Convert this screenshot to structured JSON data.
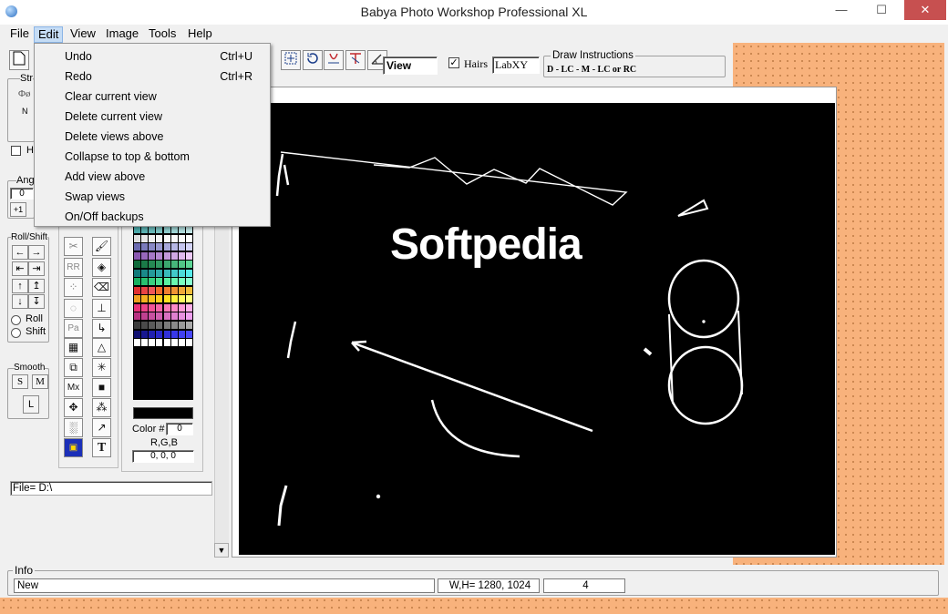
{
  "window": {
    "title": "Babya Photo Workshop Professional XL",
    "minimize": "—",
    "maximize": "☐",
    "close": "✕"
  },
  "menu": {
    "items": [
      "File",
      "Edit",
      "View",
      "Image",
      "Tools",
      "Help"
    ],
    "active": "Edit"
  },
  "edit_menu": {
    "items": [
      {
        "label": "Undo",
        "shortcut": "Ctrl+U"
      },
      {
        "label": "Redo",
        "shortcut": "Ctrl+R"
      },
      {
        "label": "Clear current view",
        "shortcut": ""
      },
      {
        "label": "Delete current view",
        "shortcut": ""
      },
      {
        "label": "Delete views above",
        "shortcut": ""
      },
      {
        "label": "Collapse to top & bottom",
        "shortcut": ""
      },
      {
        "label": "Add view above",
        "shortcut": ""
      },
      {
        "label": "Swap views",
        "shortcut": ""
      },
      {
        "label": "On/Off backups",
        "shortcut": ""
      }
    ]
  },
  "toolbar": {
    "view_field": "View",
    "hairs_label": "Hairs",
    "hairs_checked": true,
    "labxy_field": "LabXY",
    "draw_instructions_title": "Draw Instructions",
    "draw_instructions_text": "D - LC - M - LC or RC"
  },
  "left_panel": {
    "str_label": "Str",
    "n_label": "N",
    "h_label": "H",
    "angle_label": "Ang",
    "angle_value": "0",
    "angle_button": "+1",
    "roll_shift_label": "Roll/Shift",
    "roll_label": "Roll",
    "shift_label": "Shift",
    "smooth_label": "Smooth",
    "smooth_s": "S",
    "smooth_m": "M",
    "smooth_l": "L",
    "file_field": "File= D:\\"
  },
  "color_panel": {
    "color_label": "Color #",
    "color_value": "0",
    "rgb_label": "R,G,B",
    "rgb_value": "0, 0, 0"
  },
  "canvas": {
    "watermark_text": "Softpedia"
  },
  "info": {
    "label": "Info",
    "status_text": "New",
    "dimensions": "W,H= 1280, 1024",
    "count": "4"
  },
  "colors": {
    "accent_menu": "#c5dcf5",
    "background_orange": "#f8b27c",
    "close_button": "#c75050"
  }
}
